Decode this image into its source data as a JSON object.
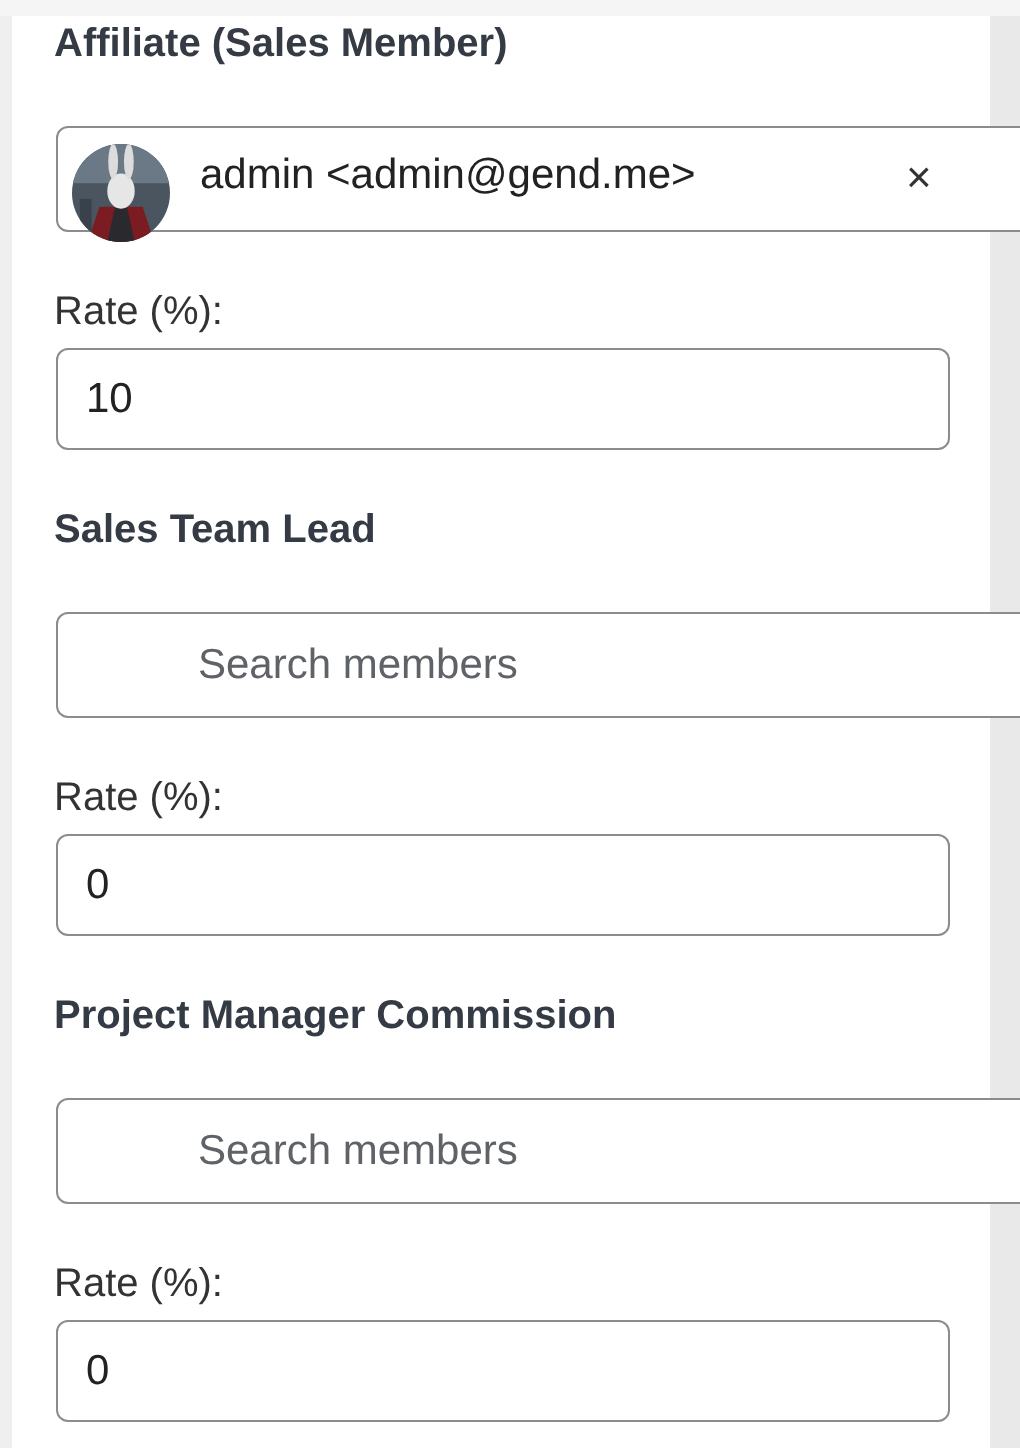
{
  "sections": [
    {
      "title": "Affiliate (Sales Member)",
      "member": {
        "label": "admin <admin@gend.me>",
        "remove": "×"
      },
      "rate_label": "Rate (%):",
      "rate": "10"
    },
    {
      "title": "Sales Team Lead",
      "search": {
        "placeholder": "Search members"
      },
      "rate_label": "Rate (%):",
      "rate": "0"
    },
    {
      "title": "Project Manager Commission",
      "search": {
        "placeholder": "Search members"
      },
      "rate_label": "Rate (%):",
      "rate": "0"
    }
  ]
}
